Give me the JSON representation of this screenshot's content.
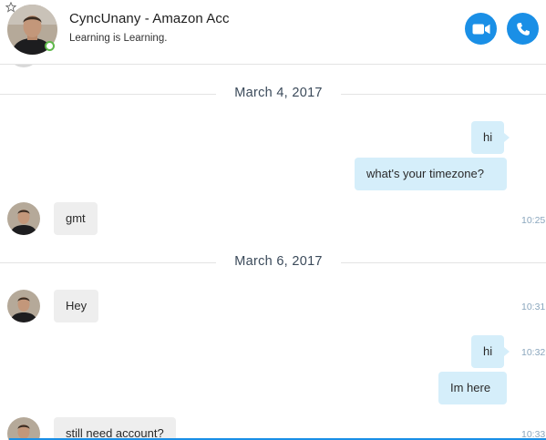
{
  "header": {
    "contact_name": "CyncUnany - Amazon Acc",
    "mood_message": "Learning is Learning.",
    "icons": {
      "favorite": "star-icon",
      "video": "video-camera-icon",
      "audio": "phone-icon"
    },
    "presence_color": "#5fb84a",
    "accent_color": "#1a8fe6"
  },
  "conversation": {
    "dates": [
      "March 4, 2017",
      "March 6, 2017"
    ],
    "messages": [
      {
        "direction": "outgoing",
        "text": "hi",
        "time": ""
      },
      {
        "direction": "outgoing",
        "text": "what's your timezone?",
        "time": ""
      },
      {
        "direction": "incoming",
        "text": "gmt",
        "time": "10:25"
      },
      {
        "direction": "incoming",
        "text": "Hey",
        "time": "10:31"
      },
      {
        "direction": "outgoing",
        "text": "hi",
        "time": "10:32"
      },
      {
        "direction": "outgoing",
        "text": "Im here",
        "time": ""
      },
      {
        "direction": "incoming",
        "text": "still need account?",
        "time": "10:33"
      }
    ],
    "colors": {
      "outgoing_bubble": "#d5eefa",
      "incoming_bubble": "#eeeeee",
      "timestamp": "#8aa6bd"
    }
  }
}
